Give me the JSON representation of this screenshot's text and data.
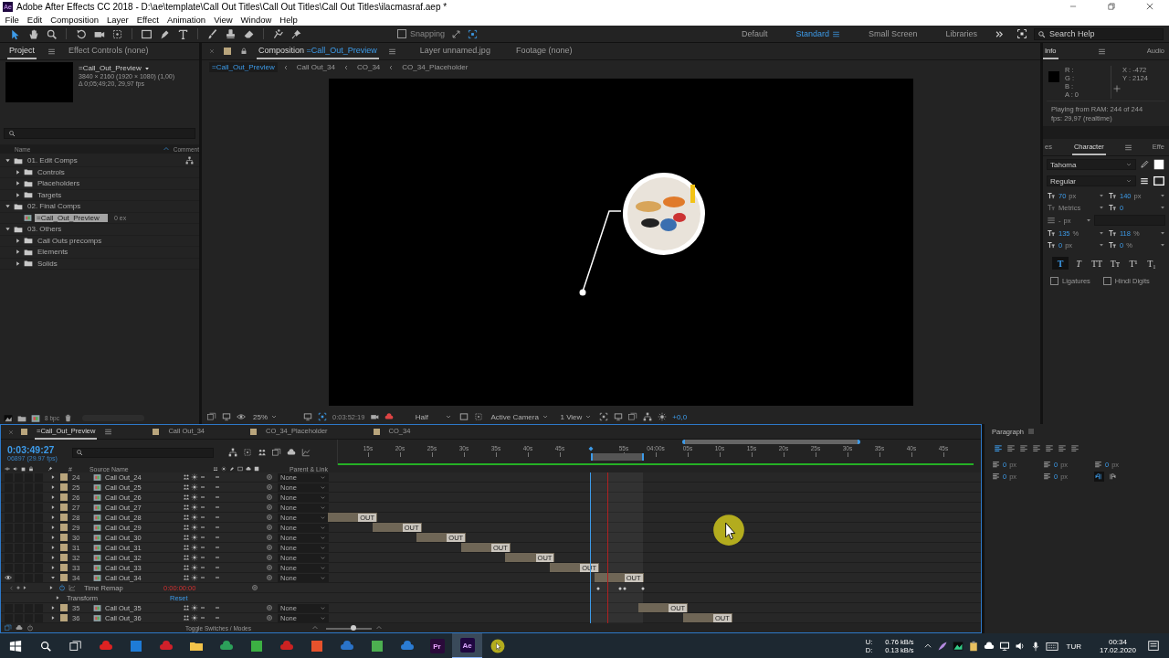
{
  "window": {
    "logo": "Ae",
    "title": "Adobe After Effects CC 2018 - D:\\ae\\template\\Call Out Titles\\Call Out Titles\\Call Out Titles\\ilacmasraf.aep *"
  },
  "menu": [
    "File",
    "Edit",
    "Composition",
    "Layer",
    "Effect",
    "Animation",
    "View",
    "Window",
    "Help"
  ],
  "toolbar": {
    "snapping": {
      "label": "Snapping",
      "checked": false
    },
    "workspaces": [
      {
        "label": "Default",
        "selected": false
      },
      {
        "label": "Standard",
        "selected": true
      },
      {
        "label": "Small Screen",
        "selected": false
      },
      {
        "label": "Libraries",
        "selected": false
      }
    ],
    "search": {
      "placeholder": "Search Help"
    }
  },
  "project": {
    "tabs": [
      {
        "label": "Project",
        "selected": true
      },
      {
        "label": "Effect Controls (none)",
        "selected": false
      }
    ],
    "selected_item": {
      "name": "=Call_Out_Preview",
      "size": "3840 × 2160  (1920 × 1080) (1,00)",
      "duration": "Δ 0;05;49;20, 29,97 fps"
    },
    "columns": [
      "Name",
      "Comment"
    ],
    "items": [
      {
        "label": "01. Edit Comps",
        "kind": "folder",
        "expanded": true,
        "selected": false,
        "children": [
          {
            "label": "Controls",
            "kind": "folder",
            "expanded": false,
            "selected": false
          },
          {
            "label": "Placeholders",
            "kind": "folder",
            "expanded": false,
            "selected": false
          },
          {
            "label": "Targets",
            "kind": "folder",
            "expanded": false,
            "selected": false
          }
        ]
      },
      {
        "label": "02. Final Comps",
        "kind": "folder",
        "expanded": true,
        "selected": false,
        "children": [
          {
            "label": "=Call_Out_Preview",
            "kind": "comp",
            "selected": true,
            "comment": "0 ex"
          }
        ]
      },
      {
        "label": "03. Others",
        "kind": "folder",
        "expanded": true,
        "selected": false,
        "children": [
          {
            "label": "Call Outs precomps",
            "kind": "folder",
            "expanded": false,
            "selected": false
          },
          {
            "label": "Elements",
            "kind": "folder",
            "expanded": false,
            "selected": false
          },
          {
            "label": "Solids",
            "kind": "folder",
            "expanded": false,
            "selected": false
          }
        ]
      }
    ],
    "bit_depth": "8 bpc"
  },
  "composition": {
    "tabs": [
      {
        "label": "Composition",
        "name": "=Call_Out_Preview",
        "selected": true
      },
      {
        "label": "Layer unnamed.jpg",
        "selected": false
      },
      {
        "label": "Footage (none)",
        "selected": false
      }
    ],
    "breadcrumbs": [
      {
        "label": "=Call_Out_Preview",
        "selected": true
      },
      {
        "label": "Call Out_34",
        "selected": false
      },
      {
        "label": "CO_34",
        "selected": false
      },
      {
        "label": "CO_34_Placeholder",
        "selected": false
      }
    ],
    "footer": {
      "zoom": "25%",
      "time": "0:03:52:19",
      "resolution": "Half",
      "camera": "Active Camera",
      "views": "1 View",
      "exposure": "+0,0"
    }
  },
  "info": {
    "tabs": [
      {
        "label": "Info",
        "selected": true
      },
      {
        "label": "Audio",
        "selected": false
      }
    ],
    "channels": [
      {
        "label": "R :"
      },
      {
        "label": "G :"
      },
      {
        "label": "B :"
      },
      {
        "label": "A :",
        "value": "0"
      }
    ],
    "x": "X : -472",
    "y": "Y : 2124",
    "status": [
      "Playing from RAM: 244 of 244",
      "fps: 29,97 (realtime)"
    ]
  },
  "character": {
    "tabs": [
      {
        "label": "es",
        "selected": false
      },
      {
        "label": "Character",
        "selected": true
      },
      {
        "label": "Effe",
        "selected": false
      }
    ],
    "font": "Tahoma",
    "style": "Regular",
    "fields": [
      {
        "kind": "size",
        "value": "70",
        "unit": "px",
        "disabled": false
      },
      {
        "kind": "leading",
        "value": "140",
        "unit": "px",
        "disabled": false
      },
      {
        "kind": "kerning",
        "value": "Metrics",
        "disabled": true
      },
      {
        "kind": "tracking",
        "value": "0",
        "disabled": false
      },
      {
        "kind": "stroke",
        "value": "-",
        "unit": "px",
        "disabled": true
      },
      {
        "kind": "vscale",
        "value": "135",
        "unit": "%",
        "disabled": false
      },
      {
        "kind": "hscale",
        "value": "118",
        "unit": "%",
        "disabled": false
      },
      {
        "kind": "baseline",
        "value": "0",
        "unit": "px",
        "disabled": false
      },
      {
        "kind": "tsume",
        "value": "0",
        "unit": "%",
        "disabled": false
      }
    ],
    "styles": [
      {
        "label": "T",
        "kind": "bold",
        "selected": true
      },
      {
        "label": "T",
        "kind": "italic",
        "selected": false
      },
      {
        "label": "TT",
        "kind": "caps",
        "selected": false
      },
      {
        "label": "Tт",
        "kind": "smallcaps",
        "selected": false
      },
      {
        "label": "T¹",
        "kind": "super",
        "selected": false
      },
      {
        "label": "T₁",
        "kind": "sub",
        "selected": false
      }
    ],
    "options": [
      {
        "label": "Ligatures",
        "checked": false
      },
      {
        "label": "Hindi Digits",
        "checked": false
      }
    ]
  },
  "timeline": {
    "tabs": [
      {
        "label": "=Call_Out_Preview",
        "selected": true
      },
      {
        "label": "Call Out_34",
        "selected": false
      },
      {
        "label": "CO_34_Placeholder",
        "selected": false
      },
      {
        "label": "CO_34",
        "selected": false
      }
    ],
    "timecode": "0:03:49:27",
    "frames": "06897 (29.97 fps)",
    "columns": [
      "#",
      "Source Name",
      "Parent & Link"
    ],
    "ruler": [
      "15s",
      "20s",
      "25s",
      "30s",
      "35s",
      "40s",
      "45s",
      "55s",
      "04:00s",
      "05s",
      "10s",
      "15s",
      "20s",
      "25s",
      "30s",
      "35s",
      "40s",
      "45s"
    ],
    "layers": [
      {
        "number": "24",
        "name": "Call Out_24",
        "parent": "None",
        "visible": false,
        "expanded": false
      },
      {
        "number": "25",
        "name": "Call Out_25",
        "parent": "None",
        "visible": false,
        "expanded": false
      },
      {
        "number": "26",
        "name": "Call Out_26",
        "parent": "None",
        "visible": false,
        "expanded": false
      },
      {
        "number": "27",
        "name": "Call Out_27",
        "parent": "None",
        "visible": false,
        "expanded": false
      },
      {
        "number": "28",
        "name": "Call Out_28",
        "parent": "None",
        "visible": false,
        "expanded": false,
        "bar": "OUT"
      },
      {
        "number": "29",
        "name": "Call Out_29",
        "parent": "None",
        "visible": false,
        "expanded": false,
        "bar": "OUT"
      },
      {
        "number": "30",
        "name": "Call Out_30",
        "parent": "None",
        "visible": false,
        "expanded": false,
        "bar": "OUT"
      },
      {
        "number": "31",
        "name": "Call Out_31",
        "parent": "None",
        "visible": false,
        "expanded": false,
        "bar": "OUT"
      },
      {
        "number": "32",
        "name": "Call Out_32",
        "parent": "None",
        "visible": false,
        "expanded": false,
        "bar": "OUT"
      },
      {
        "number": "33",
        "name": "Call Out_33",
        "parent": "None",
        "visible": false,
        "expanded": false,
        "bar": "OUT"
      },
      {
        "number": "34",
        "name": "Call Out_34",
        "parent": "None",
        "visible": true,
        "expanded": true,
        "bar": "OUT",
        "properties": [
          {
            "name": "Time Remap",
            "value": "0:00:00:00",
            "kind": "keyframed"
          },
          {
            "name": "Transform",
            "value": "Reset",
            "kind": "group"
          }
        ]
      },
      {
        "number": "35",
        "name": "Call Out_35",
        "parent": "None",
        "visible": false,
        "expanded": false,
        "bar": "OUT"
      },
      {
        "number": "36",
        "name": "Call Out_36",
        "parent": "None",
        "visible": false,
        "expanded": false,
        "bar": "OUT"
      }
    ],
    "footer": "Toggle Switches / Modes",
    "zoom_slider": {
      "level": 0.6
    }
  },
  "paragraph": {
    "title": "Paragraph",
    "fields": [
      {
        "value": "0",
        "unit": "px"
      },
      {
        "value": "0",
        "unit": "px"
      },
      {
        "value": "0",
        "unit": "px"
      },
      {
        "value": "0",
        "unit": "px"
      },
      {
        "value": "0",
        "unit": "px"
      }
    ],
    "directions": [
      {
        "kind": "ltr",
        "selected": true
      },
      {
        "kind": "rtl",
        "selected": false
      }
    ]
  },
  "taskbar": {
    "apps": [
      {
        "label": "Pr",
        "selected": false
      },
      {
        "label": "Ae",
        "selected": true
      }
    ],
    "upload_label": "U:",
    "upload": "0.76 kB/s",
    "download_label": "D:",
    "download": "0.13 kB/s",
    "language": "TUR",
    "time": "00:34",
    "date": "17.02.2020"
  }
}
